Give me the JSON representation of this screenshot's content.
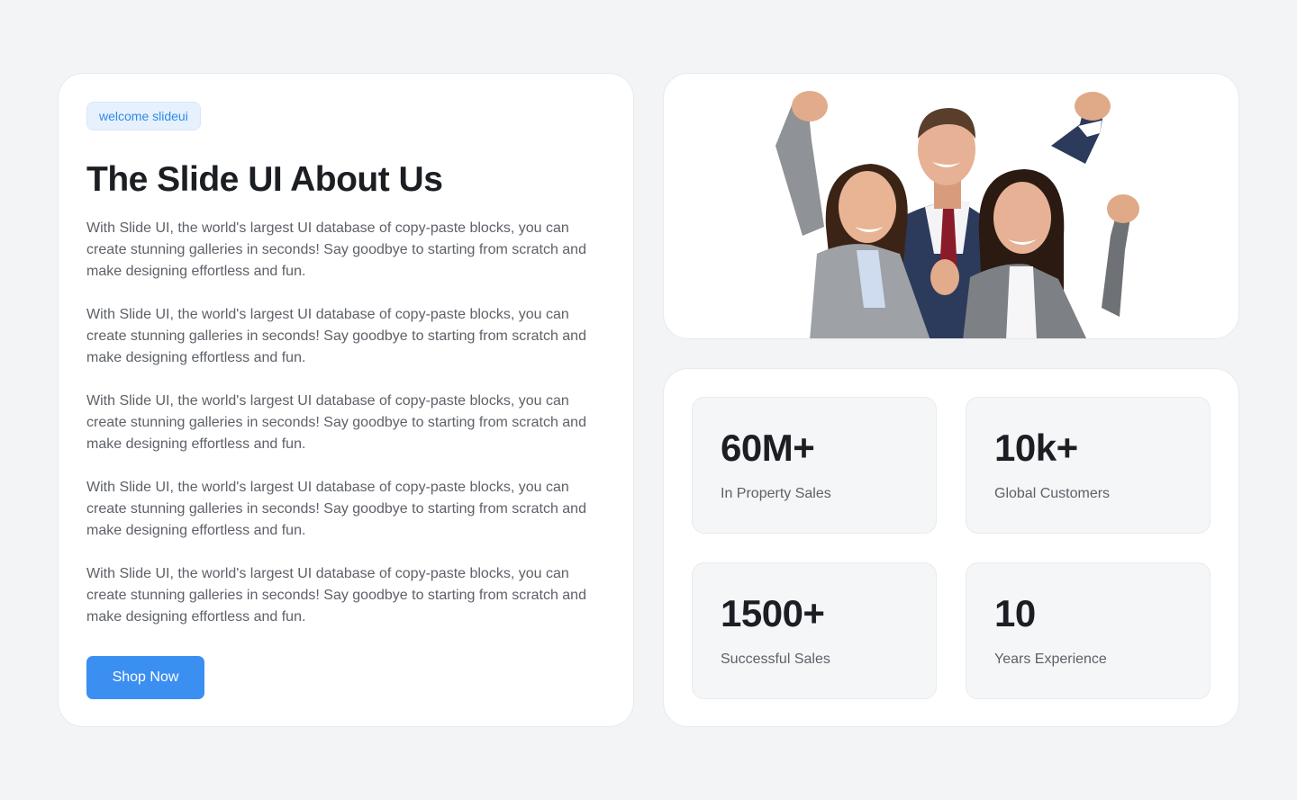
{
  "about": {
    "badge": "welcome slideui",
    "title": "The Slide UI About Us",
    "paragraphs": [
      "With Slide UI, the world's largest UI database of copy-paste blocks, you can create stunning galleries in seconds! Say goodbye to starting from scratch and make designing effortless and fun.",
      "With Slide UI, the world's largest UI database of copy-paste blocks, you can create stunning galleries in seconds! Say goodbye to starting from scratch and make designing effortless and fun.",
      "With Slide UI, the world's largest UI database of copy-paste blocks, you can create stunning galleries in seconds! Say goodbye to starting from scratch and make designing effortless and fun.",
      "With Slide UI, the world's largest UI database of copy-paste blocks, you can create stunning galleries in seconds! Say goodbye to starting from scratch and make designing effortless and fun.",
      "With Slide UI, the world's largest UI database of copy-paste blocks, you can create stunning galleries in seconds! Say goodbye to starting from scratch and make designing effortless and fun."
    ],
    "cta_label": "Shop Now"
  },
  "stats": [
    {
      "value": "60M+",
      "label": "In Property Sales"
    },
    {
      "value": "10k+",
      "label": "Global Customers"
    },
    {
      "value": "1500+",
      "label": "Successful Sales"
    },
    {
      "value": "10",
      "label": "Years Experience"
    }
  ],
  "colors": {
    "accent": "#3b8ff0",
    "badge_bg": "#e6f1fd",
    "badge_text": "#2f8ae6",
    "page_bg": "#f3f4f6",
    "heading": "#1b1f24",
    "body_text": "#5d6168"
  }
}
